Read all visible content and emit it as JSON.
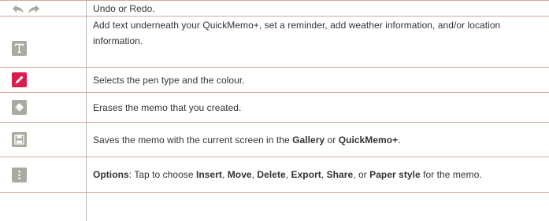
{
  "rows": [
    {
      "icons": [
        "undo-icon",
        "redo-icon"
      ],
      "text": "Undo or Redo."
    },
    {
      "icons": [
        "text-tool-icon"
      ],
      "text": "Add text underneath your QuickMemo+, set a reminder, add weather information, and/or location information."
    },
    {
      "icons": [
        "pen-icon"
      ],
      "text": "Selects the pen type and the colour."
    },
    {
      "icons": [
        "eraser-icon"
      ],
      "text": "Erases the memo that you created."
    },
    {
      "icons": [
        "save-icon"
      ],
      "text_parts": {
        "pre": "Saves the memo with the current screen in the ",
        "b1": "Gallery",
        "mid": " or ",
        "b2": "QuickMemo+",
        "post": "."
      }
    },
    {
      "icons": [
        "options-icon"
      ],
      "text_parts": {
        "b_options": "Options",
        "t1": ": Tap to choose ",
        "b_insert": "Insert",
        "c1": ", ",
        "b_move": "Move",
        "c2": ", ",
        "b_delete": "Delete",
        "c3": ", ",
        "b_export": "Export",
        "c4": ", ",
        "b_share": "Share",
        "c5": ", or ",
        "b_paper": "Paper style",
        "t2": " for the memo."
      }
    }
  ],
  "colors": {
    "rule": "#d9a59c",
    "icon_gray": "#a9aaa0",
    "icon_pink": "#d91e4f",
    "text": "#333333"
  }
}
